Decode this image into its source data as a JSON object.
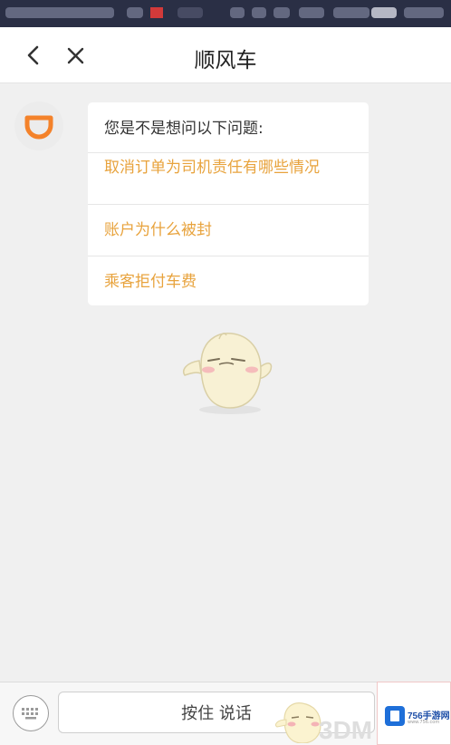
{
  "nav": {
    "title": "顺风车"
  },
  "question_card": {
    "header": "您是不是想问以下问题:",
    "items": [
      {
        "label": "取消订单为司机责任有哪些情况"
      },
      {
        "label": "账户为什么被封"
      },
      {
        "label": "乘客拒付车费"
      }
    ]
  },
  "input_bar": {
    "voice_label": "按住 说话"
  },
  "watermarks": {
    "brand_a": "3DM",
    "brand_b": "756手游网",
    "brand_b_url": "www.756.com"
  },
  "colors": {
    "accent": "#e8a33d",
    "didi_orange": "#f4822a",
    "background": "#f0f0f0"
  },
  "icons": [
    "chevron-left-icon",
    "close-icon",
    "didi-logo-icon",
    "keyboard-icon"
  ]
}
